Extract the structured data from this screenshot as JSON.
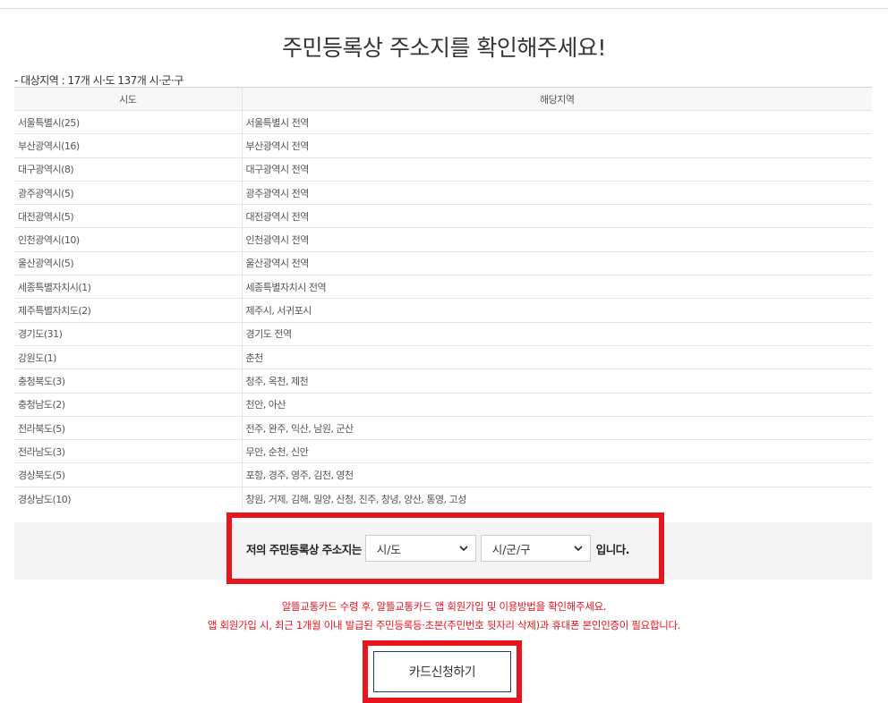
{
  "title": "주민등록상 주소지를 확인해주세요!",
  "subtitle": "- 대상지역 : 17개 시·도 137개 시·군·구",
  "table": {
    "headers": [
      "시도",
      "해당지역"
    ],
    "rows": [
      [
        "서울특별시(25)",
        "서울특별시 전역"
      ],
      [
        "부산광역시(16)",
        "부산광역시 전역"
      ],
      [
        "대구광역시(8)",
        "대구광역시 전역"
      ],
      [
        "광주광역시(5)",
        "광주광역시 전역"
      ],
      [
        "대전광역시(5)",
        "대전광역시 전역"
      ],
      [
        "인천광역시(10)",
        "인천광역시 전역"
      ],
      [
        "울산광역시(5)",
        "울산광역시 전역"
      ],
      [
        "세종특별자치시(1)",
        "세종특별자치시 전역"
      ],
      [
        "제주특별자치도(2)",
        "제주시, 서귀포시"
      ],
      [
        "경기도(31)",
        "경기도 전역"
      ],
      [
        "강원도(1)",
        "춘천"
      ],
      [
        "충청북도(3)",
        "청주, 옥천, 제천"
      ],
      [
        "충청남도(2)",
        "천안, 아산"
      ],
      [
        "전라북도(5)",
        "전주, 완주, 익산, 남원, 군산"
      ],
      [
        "전라남도(3)",
        "무안, 순천, 신안"
      ],
      [
        "경상북도(5)",
        "포항, 경주, 영주, 김천, 영천"
      ],
      [
        "경상남도(10)",
        "창원, 거제, 김해, 밀양, 산청, 진주, 창녕, 양산, 통영, 고성"
      ]
    ]
  },
  "address_select": {
    "lead": "저의 주민등록상 주소지는",
    "sido_value": "시/도",
    "sigungu_value": "시/군/구",
    "trail": "입니다."
  },
  "notice": {
    "line1": "알뜰교통카드 수령 후, 알뜰교통카드 앱 회원가입 및 이용방법을 확인해주세요.",
    "line2": "앱 회원가입 시, 최근 1개월 이내 발급된 주민등록등·초본(주민번호 뒷자리 삭제)과 휴대폰 본인인증이 필요합니다."
  },
  "apply_button": "카드신청하기",
  "colors": {
    "accent": "#e8141e",
    "button_border": "#1d3d7a"
  }
}
